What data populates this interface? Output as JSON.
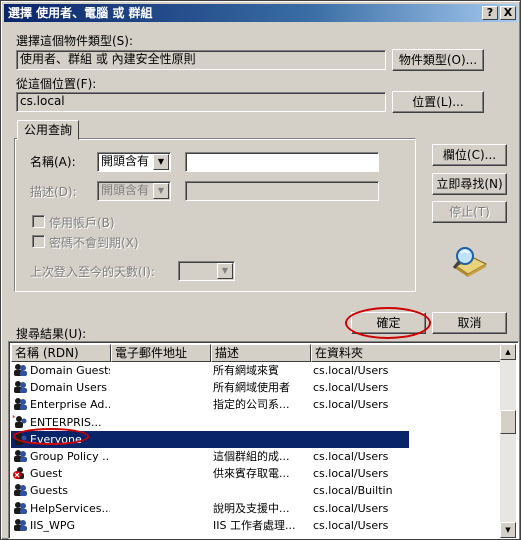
{
  "window": {
    "title": "選擇 使用者、電腦 或 群組",
    "help_btn": "?",
    "close_btn": "X"
  },
  "object_type": {
    "label": "選擇這個物件類型(S):",
    "value": "使用者、群組 或 內建安全性原則",
    "button": "物件類型(O)..."
  },
  "location": {
    "label": "從這個位置(F):",
    "value": "cs.local",
    "button": "位置(L)..."
  },
  "query": {
    "tab": "公用查詢",
    "name_label": "名稱(A):",
    "name_mode": "開頭含有",
    "desc_label": "描述(D):",
    "desc_mode": "開頭含有",
    "disabled_accounts": "停用帳戶(B)",
    "no_expire": "密碼不會到期(X)",
    "days_label": "上次登入至今的天數(I):"
  },
  "side_buttons": {
    "columns": "欄位(C)...",
    "find_now": "立即尋找(N)",
    "stop": "停止(T)"
  },
  "dialog_buttons": {
    "ok": "確定",
    "cancel": "取消"
  },
  "results": {
    "label": "搜尋結果(U):",
    "columns": [
      "名稱 (RDN)",
      "電子郵件地址",
      "描述",
      "在資料夾"
    ],
    "rows": [
      {
        "name": "Domain Guests",
        "email": "",
        "desc": "所有網域來賓",
        "folder": "cs.local/Users",
        "icon": "group-icon"
      },
      {
        "name": "Domain Users",
        "email": "",
        "desc": "所有網域使用者",
        "folder": "cs.local/Users",
        "icon": "group-icon"
      },
      {
        "name": "Enterprise Ad...",
        "email": "",
        "desc": "指定的公司系...",
        "folder": "cs.local/Users",
        "icon": "group-icon"
      },
      {
        "name": "ENTERPRIS...",
        "email": "",
        "desc": "",
        "folder": "",
        "icon": "builtin-group-icon"
      },
      {
        "name": "Everyone",
        "email": "",
        "desc": "",
        "folder": "",
        "icon": "builtin-group-icon"
      },
      {
        "name": "Group Policy ...",
        "email": "",
        "desc": "這個群組的成...",
        "folder": "cs.local/Users",
        "icon": "group-icon"
      },
      {
        "name": "Guest",
        "email": "",
        "desc": "供來賓存取電...",
        "folder": "cs.local/Users",
        "icon": "disabled-user-icon"
      },
      {
        "name": "Guests",
        "email": "",
        "desc": "",
        "folder": "cs.local/Builtin",
        "icon": "group-icon"
      },
      {
        "name": "HelpServices...",
        "email": "",
        "desc": "說明及支援中...",
        "folder": "cs.local/Users",
        "icon": "group-icon"
      },
      {
        "name": "IIS_WPG",
        "email": "",
        "desc": "IIS 工作者處理...",
        "folder": "cs.local/Users",
        "icon": "group-icon"
      }
    ]
  },
  "colors": {
    "title_start": "#0a246a",
    "title_end": "#a6caf0",
    "selection": "#0a246a",
    "highlight_ring": "#d00000"
  }
}
